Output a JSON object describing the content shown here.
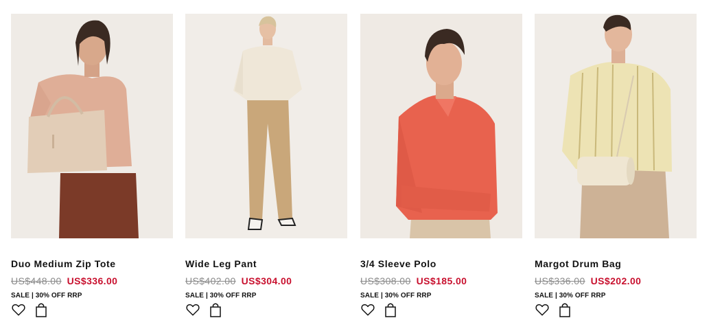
{
  "products": [
    {
      "name": "Duo Medium Zip Tote",
      "original_price": "US$448.00",
      "sale_price": "US$336.00",
      "sale_label": "SALE | 30% OFF RRP",
      "image": "model-pink-sweater-tote-bag"
    },
    {
      "name": "Wide Leg Pant",
      "original_price": "US$402.00",
      "sale_price": "US$304.00",
      "sale_label": "SALE | 30% OFF RRP",
      "image": "model-cream-blouse-tan-pants"
    },
    {
      "name": "3/4 Sleeve Polo",
      "original_price": "US$308.00",
      "sale_price": "US$185.00",
      "sale_label": "SALE | 30% OFF RRP",
      "image": "model-coral-polo"
    },
    {
      "name": "Margot Drum Bag",
      "original_price": "US$336.00",
      "sale_price": "US$202.00",
      "sale_label": "SALE | 30% OFF RRP",
      "image": "model-striped-shirt-drum-bag"
    }
  ],
  "icons": {
    "wishlist": "heart-icon",
    "cart": "shopping-bag-icon"
  },
  "colors": {
    "sale_price": "#c8102e",
    "original_price": "#8a8a8a",
    "text": "#111111",
    "photo_background": "#efebe6"
  }
}
